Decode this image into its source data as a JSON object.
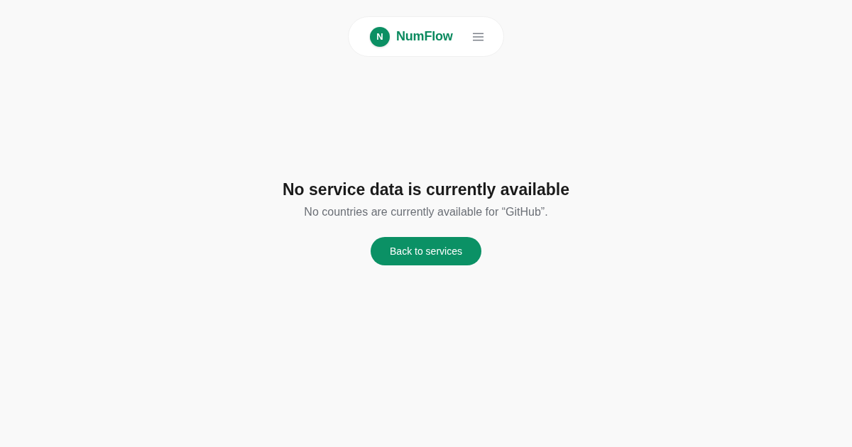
{
  "header": {
    "logo_letter": "N",
    "brand": "NumFlow"
  },
  "empty_state": {
    "title": "No service data is currently available",
    "message": "No countries are currently available for “GitHub”.",
    "button": "Back to services"
  }
}
